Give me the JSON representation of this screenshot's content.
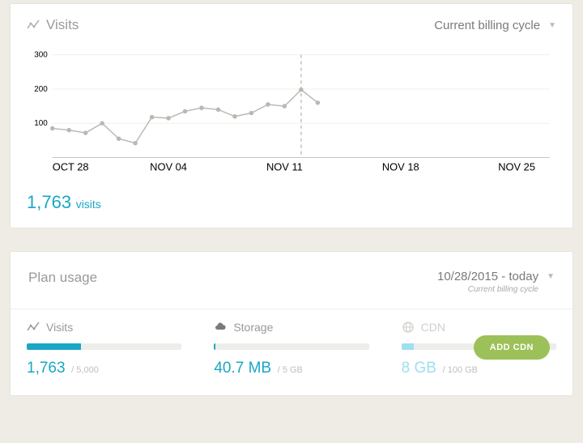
{
  "visits_card": {
    "title": "Visits",
    "period_label": "Current billing cycle",
    "summary_value": "1,763",
    "summary_unit": "visits"
  },
  "chart_data": {
    "type": "line",
    "title": "Visits",
    "xlabel": "",
    "ylabel": "",
    "ylim": [
      0,
      300
    ],
    "y_ticks": [
      100,
      200,
      300
    ],
    "x_tick_labels": [
      "OCT 28",
      "NOV 04",
      "NOV 11",
      "NOV 18",
      "NOV 25"
    ],
    "x_tick_positions": [
      0,
      7,
      14,
      21,
      28
    ],
    "today_index": 15,
    "series": [
      {
        "name": "Visits",
        "x": [
          0,
          1,
          2,
          3,
          4,
          5,
          6,
          7,
          8,
          9,
          10,
          11,
          12,
          13,
          14,
          15
        ],
        "values": [
          85,
          80,
          72,
          100,
          55,
          42,
          118,
          115,
          135,
          145,
          140,
          120,
          130,
          155,
          150,
          198,
          160
        ]
      }
    ]
  },
  "plan_card": {
    "title": "Plan usage",
    "period_label": "10/28/2015 - today",
    "period_sub": "Current billing cycle",
    "metrics": {
      "visits": {
        "label": "Visits",
        "value": "1,763",
        "limit": "/ 5,000",
        "fill_pct": 35
      },
      "storage": {
        "label": "Storage",
        "value": "40.7 MB",
        "limit": "/ 5 GB",
        "fill_pct": 1
      },
      "cdn": {
        "label": "CDN",
        "value": "8 GB",
        "limit": "/ 100 GB",
        "fill_pct": 8,
        "button": "ADD CDN"
      }
    }
  }
}
